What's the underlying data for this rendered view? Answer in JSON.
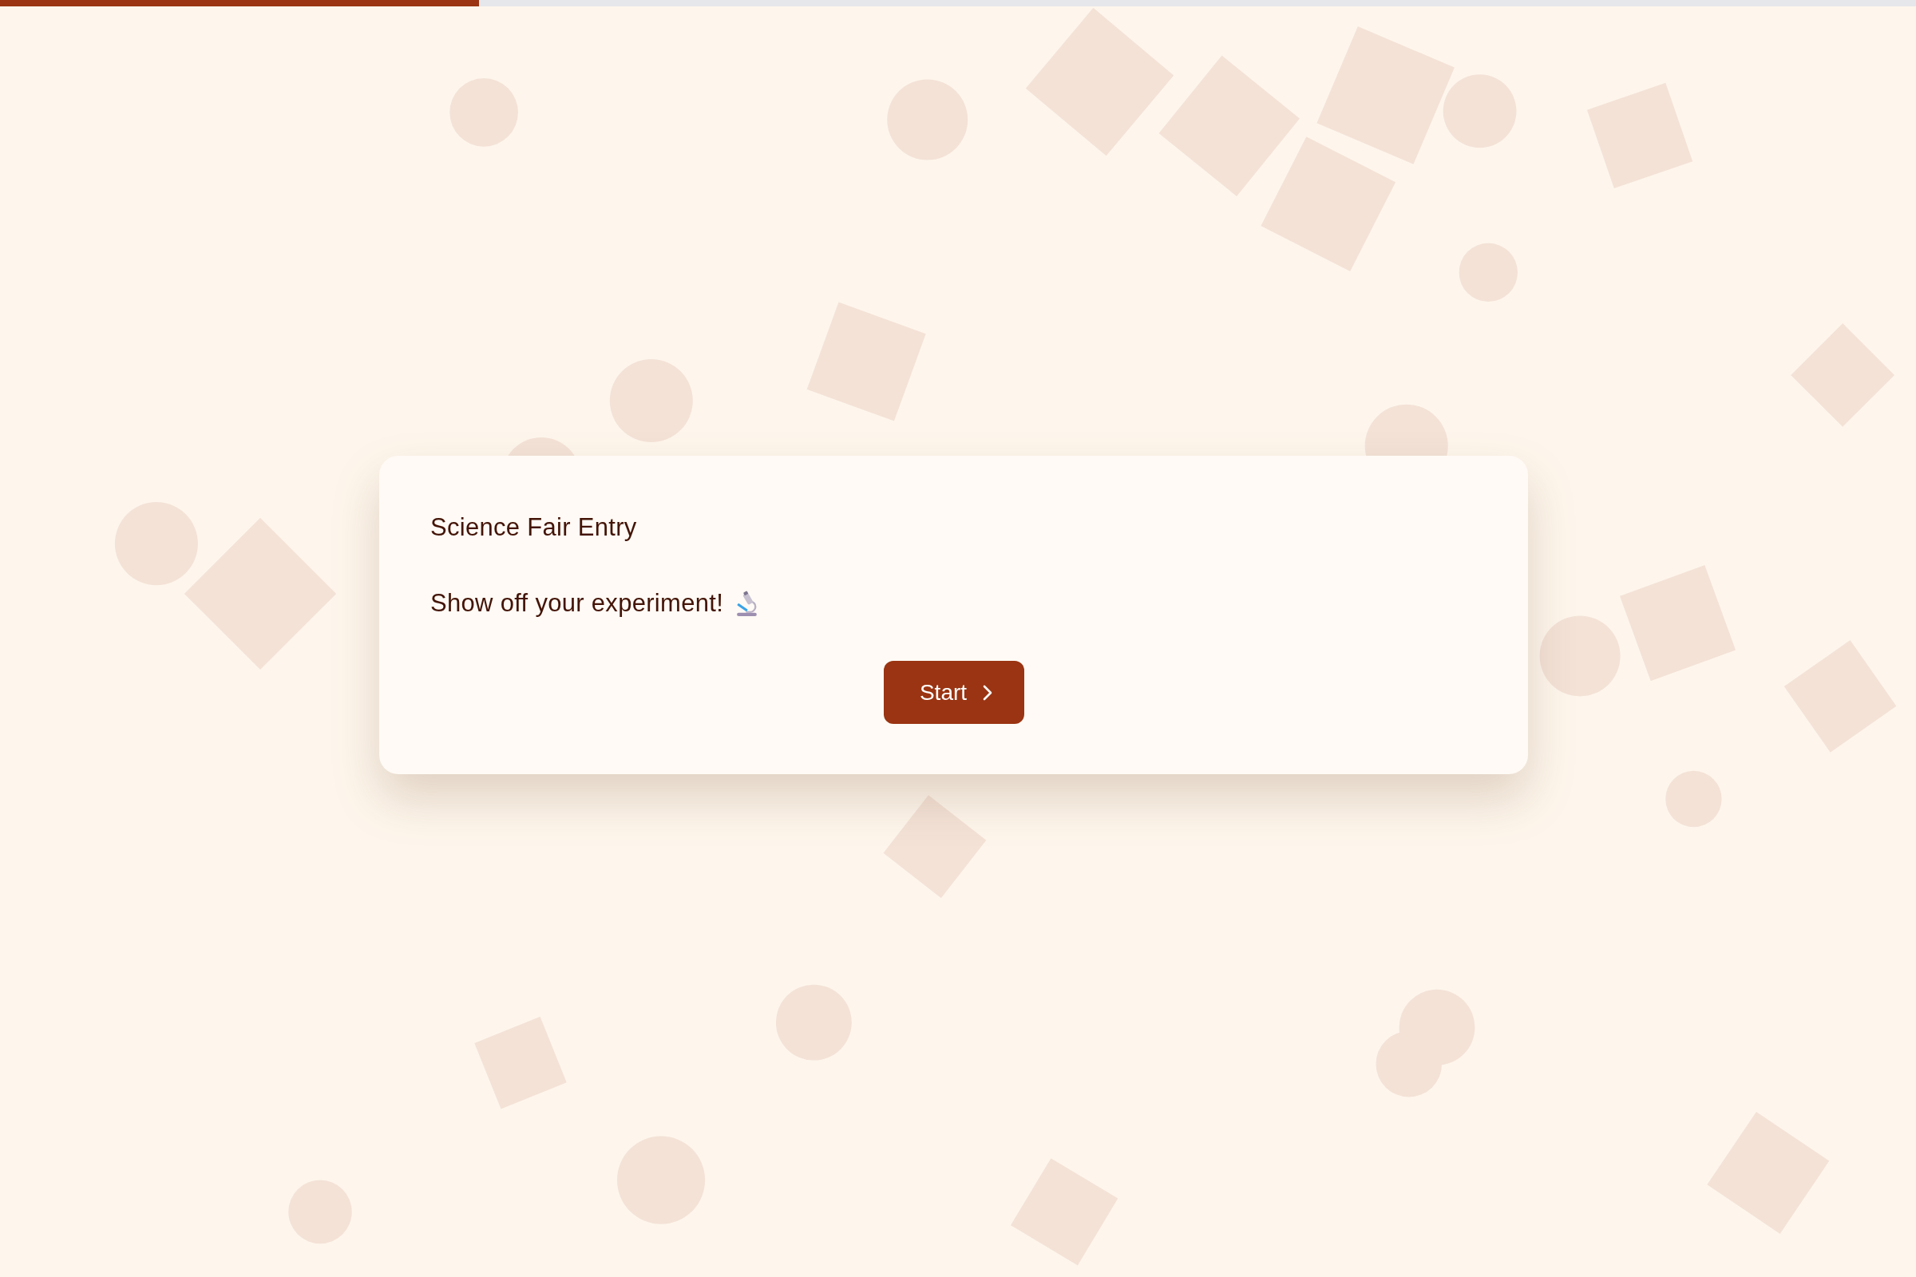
{
  "progress": {
    "level": 0.25
  },
  "card": {
    "title": "Science Fair Entry",
    "description": "Show off your experiment!",
    "button": {
      "label": "Start"
    }
  }
}
